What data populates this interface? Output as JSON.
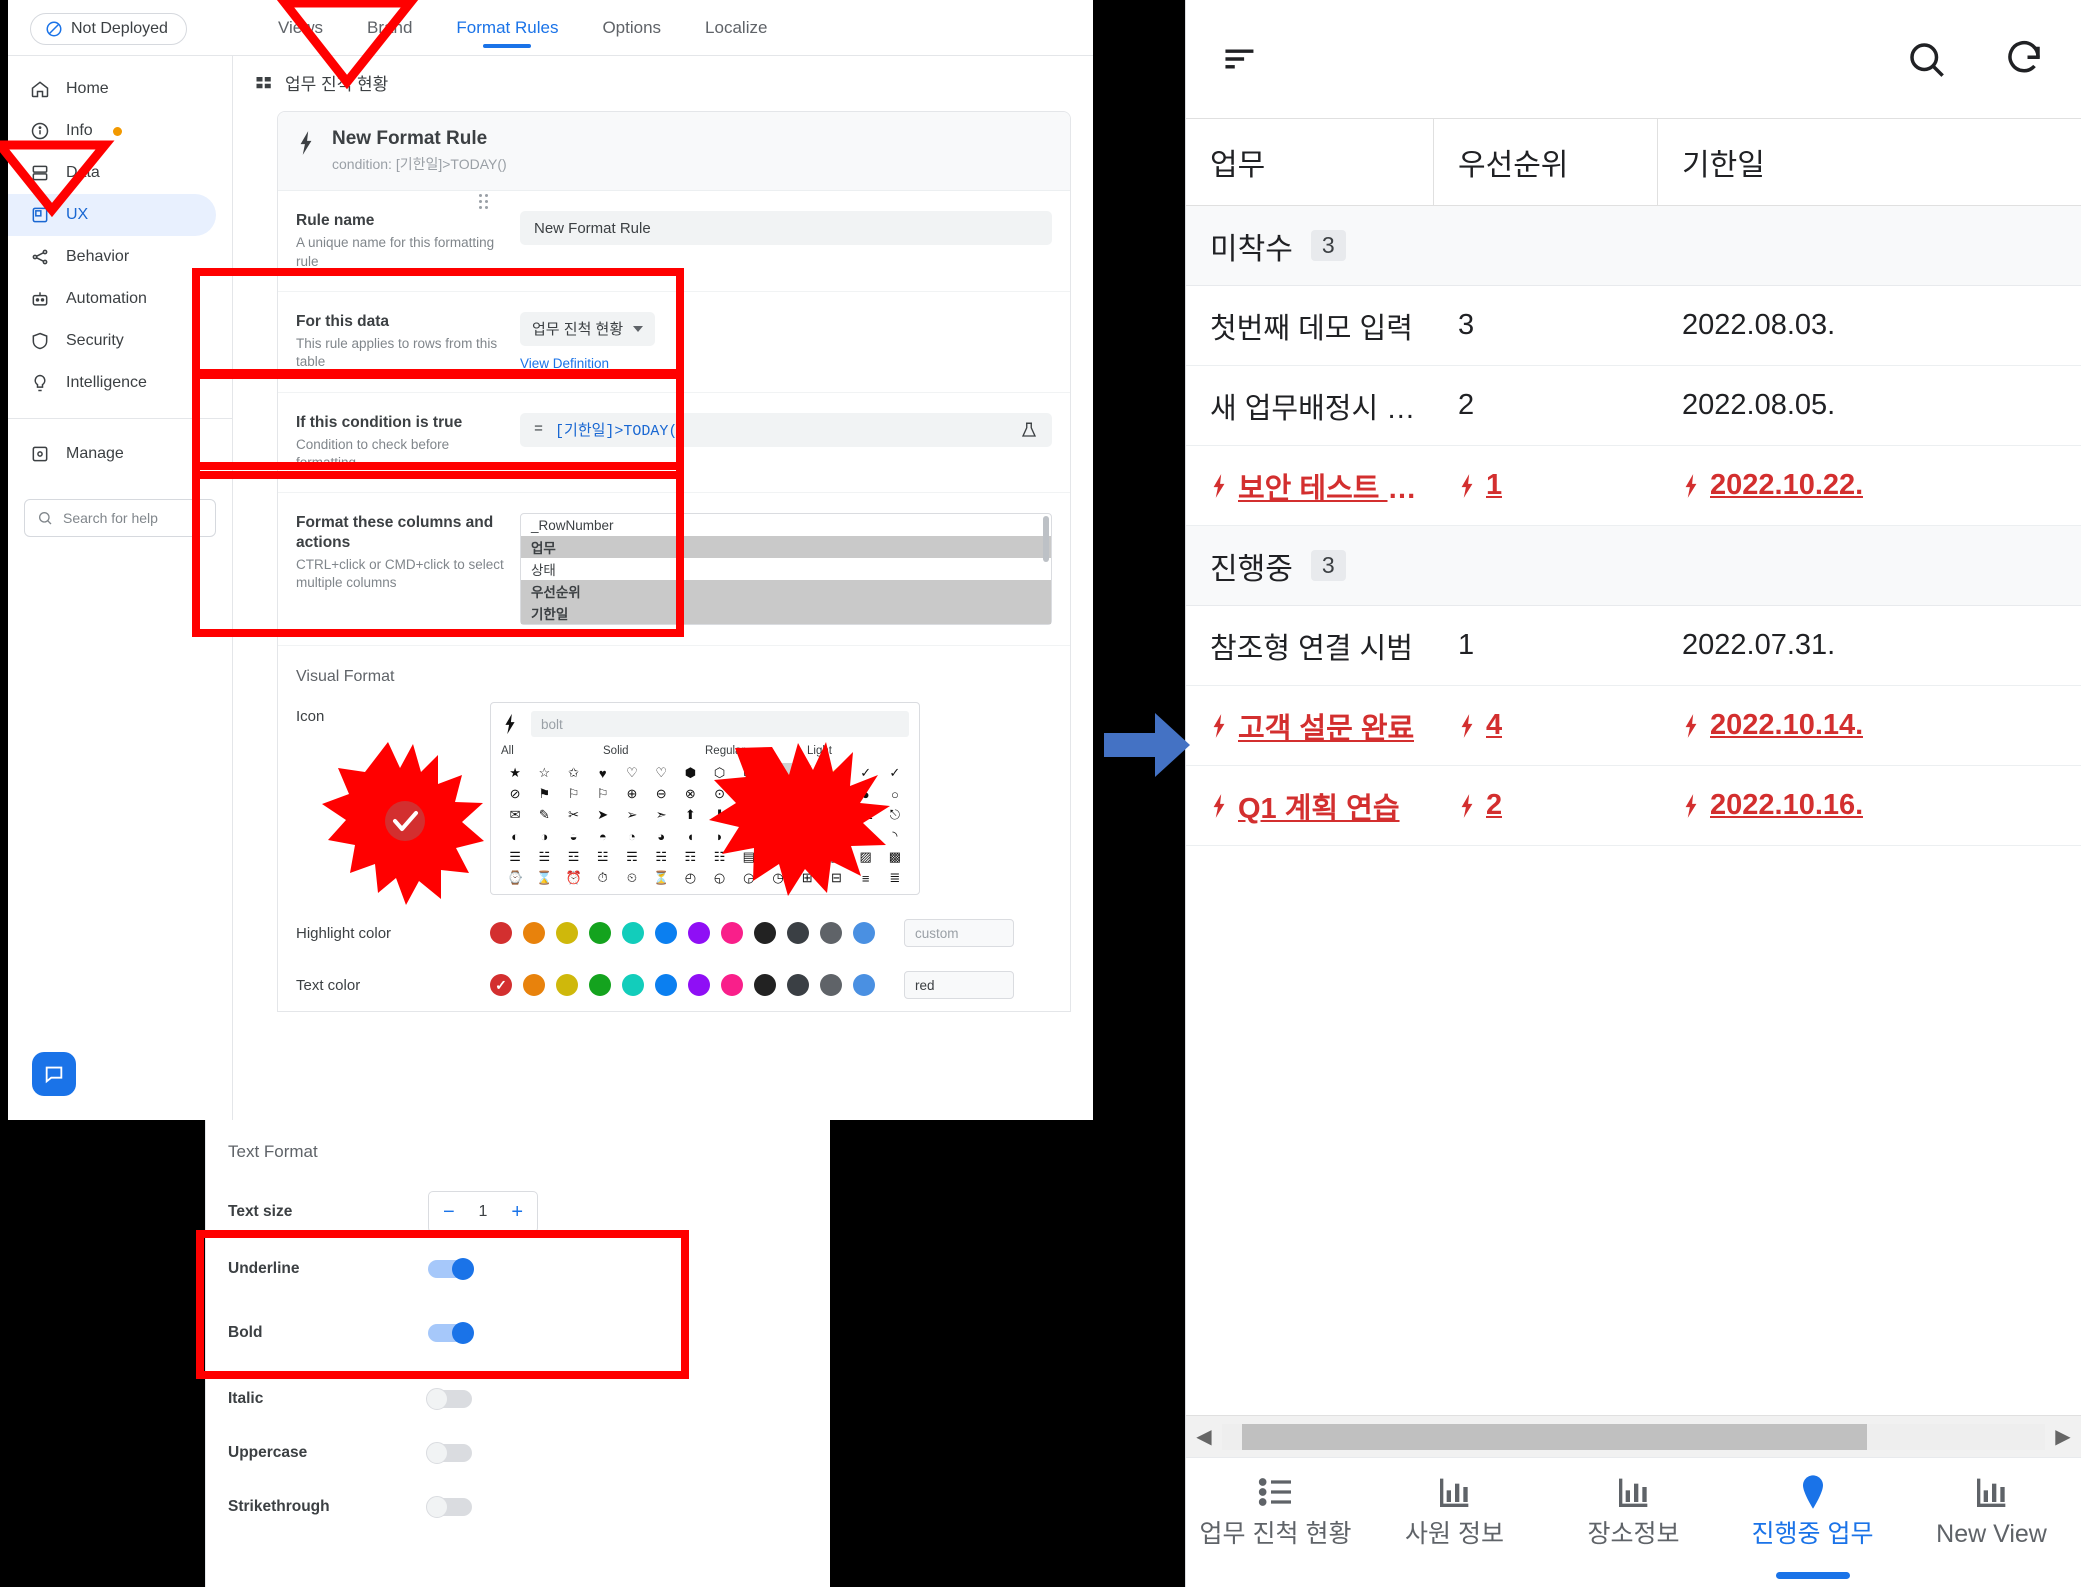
{
  "editor": {
    "deploy_status": "Not Deployed",
    "tabs": [
      {
        "label": "Views",
        "active": false
      },
      {
        "label": "Brand",
        "active": false
      },
      {
        "label": "Format Rules",
        "active": true
      },
      {
        "label": "Options",
        "active": false
      },
      {
        "label": "Localize",
        "active": false
      }
    ],
    "sidebar": {
      "items": [
        {
          "label": "Home",
          "icon": "home-icon",
          "active": false,
          "dot": false
        },
        {
          "label": "Info",
          "icon": "info-icon",
          "active": false,
          "dot": true
        },
        {
          "label": "Data",
          "icon": "data-icon",
          "active": false,
          "dot": false
        },
        {
          "label": "UX",
          "icon": "ux-icon",
          "active": true,
          "dot": false
        },
        {
          "label": "Behavior",
          "icon": "behavior-icon",
          "active": false,
          "dot": false
        },
        {
          "label": "Automation",
          "icon": "automation-robot-icon",
          "active": false,
          "dot": false
        },
        {
          "label": "Security",
          "icon": "shield-icon",
          "active": false,
          "dot": false
        },
        {
          "label": "Intelligence",
          "icon": "lightbulb-icon",
          "active": false,
          "dot": false
        }
      ],
      "manage": {
        "label": "Manage",
        "icon": "manage-icon"
      },
      "search_placeholder": "Search for help"
    },
    "view_header": {
      "title": "업무 진척 현황",
      "icon": "table-view-icon"
    },
    "rule": {
      "title": "New Format Rule",
      "condition_caption": "condition: [기한일]>TODAY()",
      "fields": [
        {
          "key": "rule_name",
          "title": "Rule name",
          "desc": "A unique name for this formatting rule",
          "value": "New Format Rule"
        },
        {
          "key": "for_this_data",
          "title": "For this data",
          "desc": "This rule applies to rows from this table",
          "value": "업무 진척 현황",
          "link": "View Definition"
        },
        {
          "key": "condition",
          "title": "If this condition is true",
          "desc": "Condition to check before formatting",
          "prefix": "=",
          "value": "[기한일]>TODAY()"
        },
        {
          "key": "columns",
          "title": "Format these columns and actions",
          "desc": "CTRL+click or CMD+click to select multiple columns"
        }
      ],
      "columns": [
        {
          "name": "_RowNumber",
          "selected": false
        },
        {
          "name": "업무",
          "selected": true
        },
        {
          "name": "상태",
          "selected": false
        },
        {
          "name": "우선순위",
          "selected": true
        },
        {
          "name": "기한일",
          "selected": true
        }
      ]
    },
    "visual_format": {
      "section_title": "Visual Format",
      "icon_label": "Icon",
      "icon_search_placeholder": "bolt",
      "icon_selected": "bolt-icon",
      "icon_tabs": [
        "All",
        "Solid",
        "Regular",
        "Light"
      ],
      "icon_glyphs": [
        "★",
        "☆",
        "✩",
        "♥",
        "♡",
        "♡",
        "⬢",
        "⬡",
        "⬡",
        "⚡",
        "⚡",
        "⚡",
        "✓",
        "✓",
        "⊘",
        "⚑",
        "⚐",
        "⚐",
        "⊕",
        "⊖",
        "⊗",
        "⊙",
        "◉",
        "◎",
        "◍",
        "◌",
        "●",
        "○",
        "✉",
        "✎",
        "✂",
        "➤",
        "➢",
        "➣",
        "⬆",
        "⬇",
        "⬅",
        "➡",
        "⌂",
        "⌘",
        "⌥",
        "⎋",
        "◐",
        "◑",
        "◒",
        "◓",
        "◔",
        "◕",
        "◖",
        "◗",
        "◘",
        "◙",
        "◚",
        "◛",
        "◜",
        "◝",
        "☰",
        "☱",
        "☲",
        "☳",
        "☴",
        "☵",
        "☶",
        "☷",
        "▤",
        "▥",
        "▦",
        "▧",
        "▨",
        "▩",
        "⌚",
        "⌛",
        "⏰",
        "⏱",
        "⏲",
        "⏳",
        "◴",
        "◵",
        "◶",
        "◷",
        "⊞",
        "⊟",
        "≡",
        "≣"
      ],
      "highlight_color": {
        "label": "Highlight color",
        "swatches": [
          "#d32f2f",
          "#e8820c",
          "#cfb80b",
          "#14a31e",
          "#12cdbb",
          "#0b7ff0",
          "#8f0ff5",
          "#f91f8a",
          "#222222",
          "#3a3f44",
          "#5f6368",
          "#4a90e2"
        ],
        "input_placeholder": "custom",
        "input_value": "",
        "selected_index": -1
      },
      "text_color": {
        "label": "Text color",
        "swatches": [
          "#d32f2f",
          "#e8820c",
          "#cfb80b",
          "#14a31e",
          "#12cdbb",
          "#0b7ff0",
          "#8f0ff5",
          "#f91f8a",
          "#222222",
          "#3a3f44",
          "#5f6368",
          "#4a90e2"
        ],
        "input_placeholder": "",
        "input_value": "red",
        "selected_index": 0
      }
    },
    "text_format": {
      "section_title": "Text Format",
      "text_size": {
        "label": "Text size",
        "value": "1",
        "minus": "−",
        "plus": "+"
      },
      "toggles": [
        {
          "label": "Underline",
          "on": true
        },
        {
          "label": "Bold",
          "on": true
        },
        {
          "label": "Italic",
          "on": false
        },
        {
          "label": "Uppercase",
          "on": false
        },
        {
          "label": "Strikethrough",
          "on": false
        }
      ]
    }
  },
  "phone": {
    "toolbar": {
      "menu_icon": "sort-lines-icon",
      "search_icon": "search-icon",
      "refresh_icon": "refresh-icon"
    },
    "table": {
      "headers": [
        "업무",
        "우선순위",
        "기한일"
      ],
      "groups": [
        {
          "name": "미착수",
          "count": "3",
          "rows": [
            {
              "task": "첫번째 데모 입력",
              "priority": "3",
              "due": "2022.08.03.",
              "alert": false
            },
            {
              "task": "새 업무배정시 자...",
              "priority": "2",
              "due": "2022.08.05.",
              "alert": false
            },
            {
              "task": "보안 테스트 완...",
              "priority": "1",
              "due": "2022.10.22.",
              "alert": true
            }
          ]
        },
        {
          "name": "진행중",
          "count": "3",
          "rows": [
            {
              "task": "참조형 연결 시범",
              "priority": "1",
              "due": "2022.07.31.",
              "alert": false
            },
            {
              "task": "고객 설문 완료",
              "priority": "4",
              "due": "2022.10.14.",
              "alert": true
            },
            {
              "task": "Q1 계획 연습",
              "priority": "2",
              "due": "2022.10.16.",
              "alert": true
            }
          ]
        }
      ]
    },
    "nav": [
      {
        "label": "업무 진척 현황",
        "icon": "list-icon",
        "active": false
      },
      {
        "label": "사원 정보",
        "icon": "chart-icon",
        "active": false
      },
      {
        "label": "장소정보",
        "icon": "chart-icon",
        "active": false
      },
      {
        "label": "진행중 업무",
        "icon": "map-pin-icon",
        "active": true
      },
      {
        "label": "New View",
        "icon": "chart-icon",
        "active": false
      }
    ]
  }
}
